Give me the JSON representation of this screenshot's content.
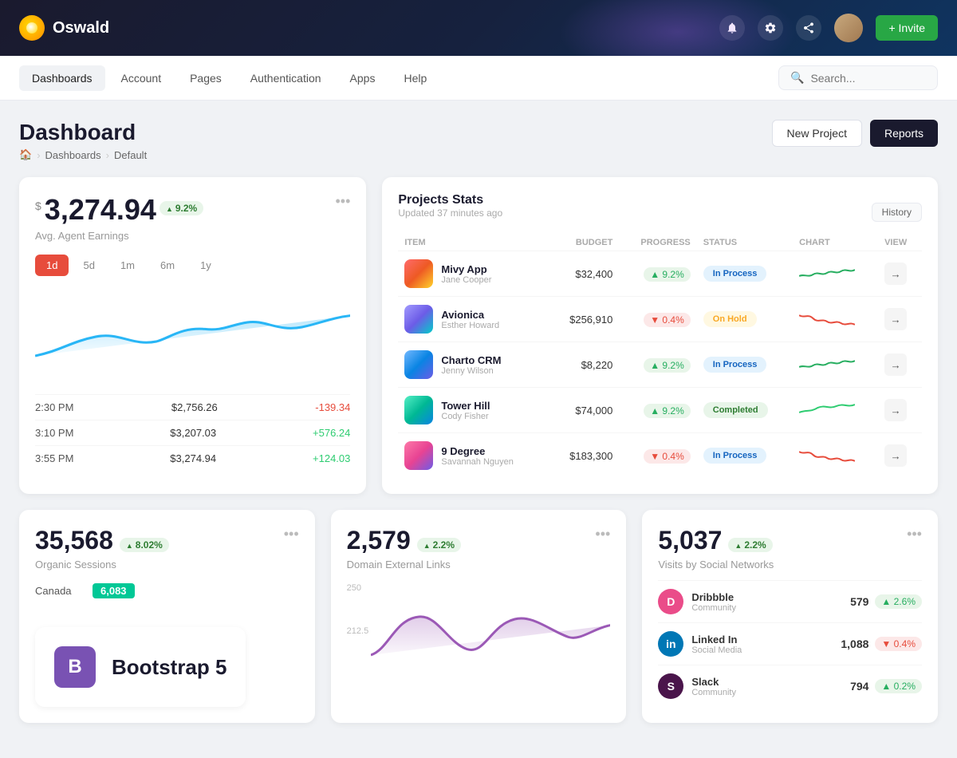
{
  "topbar": {
    "logo_text": "Oswald",
    "invite_label": "+ Invite"
  },
  "navbar": {
    "items": [
      {
        "label": "Dashboards",
        "active": true
      },
      {
        "label": "Account",
        "active": false
      },
      {
        "label": "Pages",
        "active": false
      },
      {
        "label": "Authentication",
        "active": false
      },
      {
        "label": "Apps",
        "active": false
      },
      {
        "label": "Help",
        "active": false
      }
    ],
    "search_placeholder": "Search..."
  },
  "page": {
    "title": "Dashboard",
    "breadcrumb": [
      "Dashboards",
      "Default"
    ],
    "new_project_label": "New Project",
    "reports_label": "Reports"
  },
  "earnings": {
    "currency": "$",
    "amount": "3,274.94",
    "badge": "9.2%",
    "label": "Avg. Agent Earnings",
    "periods": [
      "1d",
      "5d",
      "1m",
      "6m",
      "1y"
    ],
    "active_period": "1d",
    "entries": [
      {
        "time": "2:30 PM",
        "amount": "$2,756.26",
        "change": "-139.34",
        "type": "neg"
      },
      {
        "time": "3:10 PM",
        "amount": "$3,207.03",
        "change": "+576.24",
        "type": "pos"
      },
      {
        "time": "3:55 PM",
        "amount": "$3,274.94",
        "change": "+124.03",
        "type": "pos"
      }
    ]
  },
  "projects": {
    "title": "Projects Stats",
    "subtitle": "Updated 37 minutes ago",
    "history_label": "History",
    "columns": [
      "ITEM",
      "BUDGET",
      "PROGRESS",
      "STATUS",
      "CHART",
      "VIEW"
    ],
    "rows": [
      {
        "name": "Mivy App",
        "person": "Jane Cooper",
        "budget": "$32,400",
        "progress": "9.2%",
        "progress_type": "up",
        "status": "In Process",
        "status_key": "inprocess",
        "chart_type": "green"
      },
      {
        "name": "Avionica",
        "person": "Esther Howard",
        "budget": "$256,910",
        "progress": "0.4%",
        "progress_type": "down",
        "status": "On Hold",
        "status_key": "onhold",
        "chart_type": "red"
      },
      {
        "name": "Charto CRM",
        "person": "Jenny Wilson",
        "budget": "$8,220",
        "progress": "9.2%",
        "progress_type": "up",
        "status": "In Process",
        "status_key": "inprocess",
        "chart_type": "green"
      },
      {
        "name": "Tower Hill",
        "person": "Cody Fisher",
        "budget": "$74,000",
        "progress": "9.2%",
        "progress_type": "up",
        "status": "Completed",
        "status_key": "completed",
        "chart_type": "green2"
      },
      {
        "name": "9 Degree",
        "person": "Savannah Nguyen",
        "budget": "$183,300",
        "progress": "0.4%",
        "progress_type": "down",
        "status": "In Process",
        "status_key": "inprocess",
        "chart_type": "red"
      }
    ]
  },
  "organic": {
    "value": "35,568",
    "badge": "8.02%",
    "label": "Organic Sessions",
    "country": "Canada",
    "country_value": "6,083"
  },
  "domain": {
    "value": "2,579",
    "badge": "2.2%",
    "label": "Domain External Links",
    "chart_max": "250",
    "chart_mid": "212.5"
  },
  "social": {
    "value": "5,037",
    "badge": "2.2%",
    "label": "Visits by Social Networks",
    "items": [
      {
        "name": "Dribbble",
        "type": "Community",
        "count": "579",
        "change": "2.6%",
        "change_type": "up"
      },
      {
        "name": "Linked In",
        "type": "Social Media",
        "count": "1,088",
        "change": "0.4%",
        "change_type": "down"
      },
      {
        "name": "Slack",
        "type": "Community",
        "count": "794",
        "change": "0.2%",
        "change_type": "up"
      }
    ]
  },
  "bootstrap": {
    "title": "Bootstrap 5",
    "icon_letter": "B"
  }
}
